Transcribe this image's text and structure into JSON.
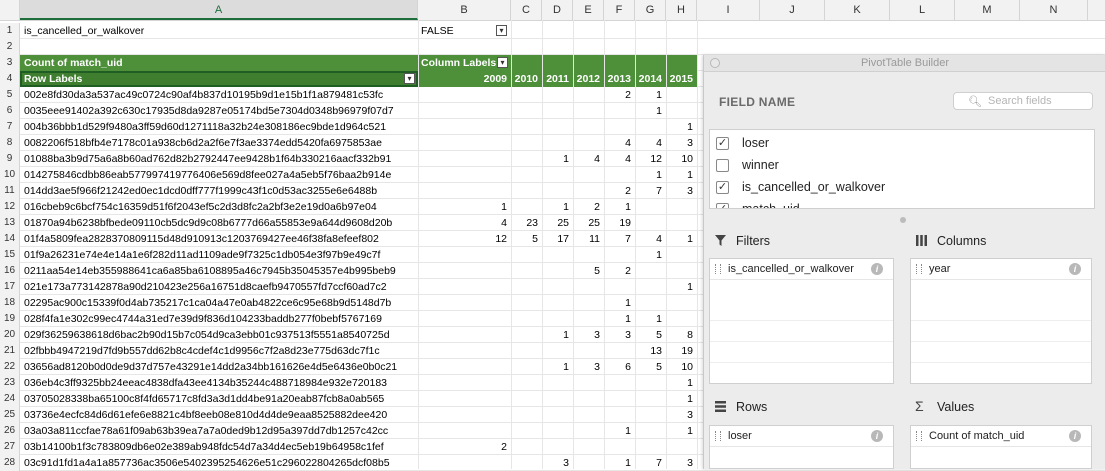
{
  "columns": [
    "A",
    "B",
    "C",
    "D",
    "E",
    "F",
    "G",
    "H",
    "I",
    "J",
    "K",
    "L",
    "M",
    "N"
  ],
  "row1": {
    "label": "is_cancelled_or_walkover",
    "value": "FALSE"
  },
  "header3": {
    "count": "Count of match_uid",
    "column_labels": "Column Labels"
  },
  "header4": {
    "row_labels": "Row Labels",
    "years": [
      "2009",
      "2010",
      "2011",
      "2012",
      "2013",
      "2014",
      "2015"
    ]
  },
  "rows": [
    {
      "n": "5",
      "id": "002e8fd30da3a537ac49c0724c90af4b837d10195b9d1e15b1f1a879481c53fc",
      "v": [
        "",
        "",
        "",
        "",
        "2",
        "1",
        ""
      ]
    },
    {
      "n": "6",
      "id": "0035eee91402a392c630c17935d8da9287e05174bd5e7304d0348b96979f07d7",
      "v": [
        "",
        "",
        "",
        "",
        "",
        "1",
        ""
      ]
    },
    {
      "n": "7",
      "id": "004b36bbb1d529f9480a3ff59d60d1271118a32b24e308186ec9bde1d964c521",
      "v": [
        "",
        "",
        "",
        "",
        "",
        "",
        "1"
      ]
    },
    {
      "n": "8",
      "id": "0082206f518bfb4e7178c01a938cb6d2a2f6e7f3ae3374edd5420fa6975853ae",
      "v": [
        "",
        "",
        "",
        "",
        "4",
        "4",
        "3"
      ]
    },
    {
      "n": "9",
      "id": "01088ba3b9d75a6a8b60ad762d82b2792447ee9428b1f64b330216aacf332b91",
      "v": [
        "",
        "",
        "1",
        "4",
        "4",
        "12",
        "10"
      ]
    },
    {
      "n": "10",
      "id": "014275846cdbb86eab577997419776406e569d8fee027a4a5eb5f76baa2b914e",
      "v": [
        "",
        "",
        "",
        "",
        "",
        "1",
        "1"
      ]
    },
    {
      "n": "11",
      "id": "014dd3ae5f966f21242ed0ec1dcd0dff777f1999c43f1c0d53ac3255e6e6488b",
      "v": [
        "",
        "",
        "",
        "",
        "2",
        "7",
        "3"
      ]
    },
    {
      "n": "12",
      "id": "016cbeb9c6bcf754c16359d51f6f2043ef5c2d3d8fc2a2bf3e2e19d0a6b97e04",
      "v": [
        "1",
        "",
        "1",
        "2",
        "1",
        "",
        ""
      ]
    },
    {
      "n": "13",
      "id": "01870a94b6238bfbede09110cb5dc9d9c08b6777d66a55853e9a644d9608d20b",
      "v": [
        "4",
        "23",
        "25",
        "25",
        "19",
        "",
        ""
      ]
    },
    {
      "n": "14",
      "id": "01f4a5809fea2828370809115d48d910913c1203769427ee46f38fa8efeef802",
      "v": [
        "12",
        "5",
        "17",
        "11",
        "7",
        "4",
        "1"
      ]
    },
    {
      "n": "15",
      "id": "01f9a26231e74e4e14a1e6f282d11ad1109ade9f7325c1db054e3f97b9e49c7f",
      "v": [
        "",
        "",
        "",
        "",
        "",
        "1",
        ""
      ]
    },
    {
      "n": "16",
      "id": "0211aa54e14eb355988641ca6a85ba6108895a46c7945b35045357e4b995beb9",
      "v": [
        "",
        "",
        "",
        "5",
        "2",
        "",
        ""
      ]
    },
    {
      "n": "17",
      "id": "021e173a773142878a90d210423e256a16751d8caefb9470557fd7ccf60ad7c2",
      "v": [
        "",
        "",
        "",
        "",
        "",
        "",
        "1"
      ]
    },
    {
      "n": "18",
      "id": "02295ac900c15339f0d4ab735217c1ca04a47e0ab4822ce6c95e68b9d5148d7b",
      "v": [
        "",
        "",
        "",
        "",
        "1",
        "",
        ""
      ]
    },
    {
      "n": "19",
      "id": "028f4fa1e302c99ec4744a31ed7e39d9f836d104233baddb277f0bebf5767169",
      "v": [
        "",
        "",
        "",
        "",
        "1",
        "1",
        ""
      ]
    },
    {
      "n": "20",
      "id": "029f36259638618d6bac2b90d15b7c054d9ca3ebb01c937513f5551a8540725d",
      "v": [
        "",
        "",
        "1",
        "3",
        "3",
        "5",
        "8"
      ]
    },
    {
      "n": "21",
      "id": "02fbbb4947219d7fd9b557dd62b8c4cdef4c1d9956c7f2a8d23e775d63dc7f1c",
      "v": [
        "",
        "",
        "",
        "",
        "",
        "13",
        "19"
      ]
    },
    {
      "n": "22",
      "id": "03656ad8120b0d0de9d37d757e43291e14dd2a34bb161626e4d5e6436e0b0c21",
      "v": [
        "",
        "",
        "1",
        "3",
        "6",
        "5",
        "10"
      ]
    },
    {
      "n": "23",
      "id": "036eb4c3ff9325bb24eeac4838dfa43ee4134b35244c488718984e932e720183",
      "v": [
        "",
        "",
        "",
        "",
        "",
        "",
        "1"
      ]
    },
    {
      "n": "24",
      "id": "03705028338ba65100c8f4fd65717c8fd3a3d1dd4be91a20eab87fcb8a0ab565",
      "v": [
        "",
        "",
        "",
        "",
        "",
        "",
        "1"
      ]
    },
    {
      "n": "25",
      "id": "03736e4ecfc84d6d61efe6e8821c4bf8eeb08e810d4d4de9eaa8525882dee420",
      "v": [
        "",
        "",
        "",
        "",
        "",
        "",
        "3"
      ]
    },
    {
      "n": "26",
      "id": "03a03a811ccfae78a61f09ab63b39ea7a7a0ded9b12d95a397dd7db1257c42cc",
      "v": [
        "",
        "",
        "",
        "",
        "1",
        "",
        "1"
      ]
    },
    {
      "n": "27",
      "id": "03b14100b1f3c783809db6e02e389ab948fdc54d7a34d4ec5eb19b64958c1fef",
      "v": [
        "2",
        "",
        "",
        "",
        "",
        "",
        ""
      ]
    },
    {
      "n": "28",
      "id": "03c91d1fd1a4a1a857736ac3506e5402395254626e51c296022804265dcf08b5",
      "v": [
        "",
        "",
        "3",
        "",
        "1",
        "7",
        "3"
      ]
    }
  ],
  "panel": {
    "title": "PivotTable Builder",
    "field_name": "FIELD NAME",
    "search_placeholder": "Search fields",
    "fields": [
      {
        "label": "loser",
        "checked": true
      },
      {
        "label": "winner",
        "checked": false
      },
      {
        "label": "is_cancelled_or_walkover",
        "checked": true
      },
      {
        "label": "match_uid",
        "checked": true
      }
    ],
    "filters": {
      "title": "Filters",
      "item": "is_cancelled_or_walkover"
    },
    "columns": {
      "title": "Columns",
      "item": "year"
    },
    "rows": {
      "title": "Rows",
      "item": "loser"
    },
    "values": {
      "title": "Values",
      "item": "Count of match_uid"
    }
  },
  "colors": {
    "pivot_header": "#4e8f3a",
    "accent": "#1e6e3c"
  }
}
